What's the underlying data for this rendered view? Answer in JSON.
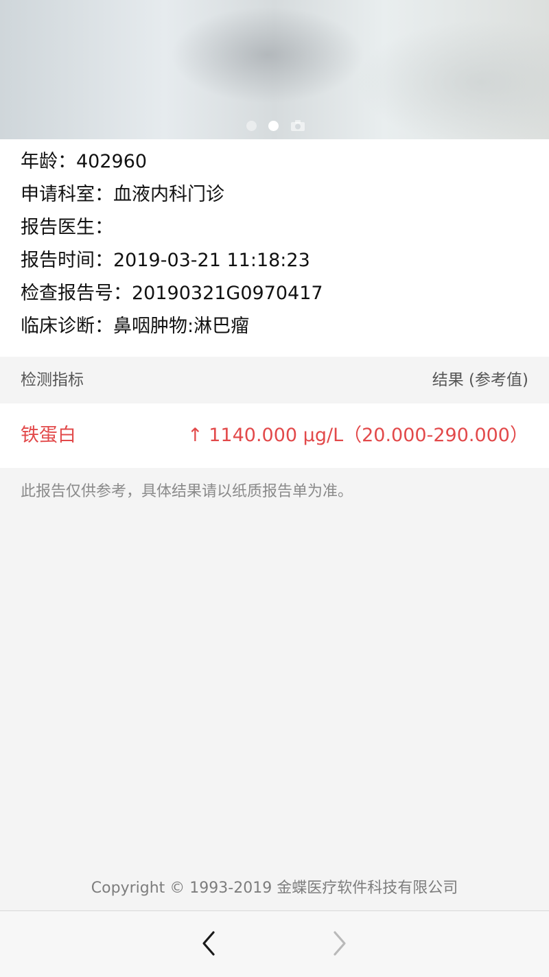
{
  "banner": {
    "page_indicator": {
      "count": 2,
      "active_index": 1
    },
    "camera_icon": "camera-icon"
  },
  "info": {
    "age": "年龄：402960",
    "department": "申请科室：血液内科门诊",
    "doctor": "报告医生：",
    "report_time": "报告时间：2019-03-21 11:18:23",
    "report_number": "检查报告号：20190321G0970417",
    "diagnosis": "临床诊断：鼻咽肿物:淋巴瘤"
  },
  "table": {
    "header_left": "检测指标",
    "header_right": "结果 (参考值)",
    "rows": [
      {
        "name": "铁蛋白",
        "value": "↑ 1140.000 μg/L（20.000-290.000）",
        "status_color": "#e2494a"
      }
    ]
  },
  "disclaimer": "此报告仅供参考，具体结果请以纸质报告单为准。",
  "copyright": "Copyright © 1993-2019 金蝶医疗软件科技有限公司",
  "navbar": {
    "back_icon": "chevron-left-icon",
    "forward_icon": "chevron-right-icon"
  }
}
